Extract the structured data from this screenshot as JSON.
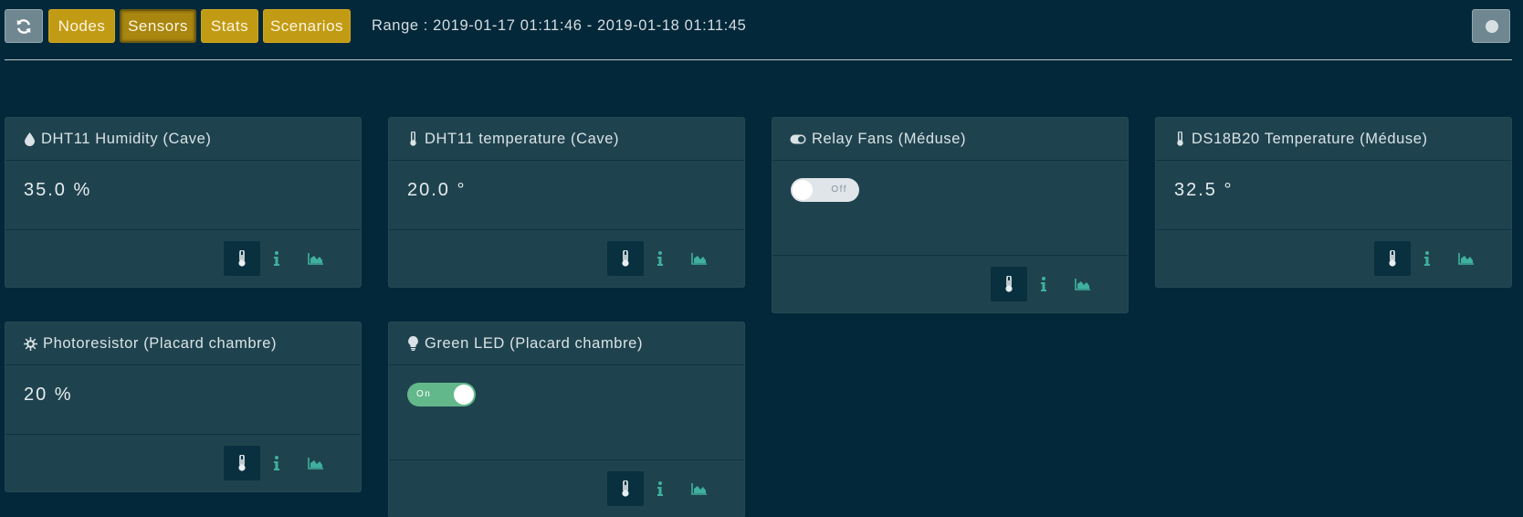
{
  "toolbar": {
    "refresh_icon": "refresh-icon",
    "buttons": [
      {
        "label": "Nodes"
      },
      {
        "label": "Sensors"
      },
      {
        "label": "Stats"
      },
      {
        "label": "Scenarios"
      }
    ],
    "range_text": "Range : 2019-01-17 01:11:46 - 2019-01-18 01:11:45",
    "status_icon": "status-dot-icon"
  },
  "colors": {
    "background": "#03283a",
    "card": "#1f434e",
    "gold": "#c29b14",
    "teal_icon": "#3fb0a0",
    "toggle_on": "#63b88b"
  },
  "sensors": [
    {
      "title": "DHT11 Humidity (Cave)",
      "icon": "droplet-icon",
      "value": "35.0 %"
    },
    {
      "title": "DHT11 temperature (Cave)",
      "icon": "thermometer-icon",
      "value": "20.0 °"
    },
    {
      "title": "Relay Fans (Méduse)",
      "icon": "toggle-icon",
      "toggle": "Off"
    },
    {
      "title": "DS18B20 Temperature (Méduse)",
      "icon": "thermometer-icon",
      "value": "32.5 °"
    },
    {
      "title": "Photoresistor (Placard chambre)",
      "icon": "sun-icon",
      "value": "20 %"
    },
    {
      "title": "Green LED (Placard chambre)",
      "icon": "bulb-icon",
      "toggle": "On"
    }
  ]
}
